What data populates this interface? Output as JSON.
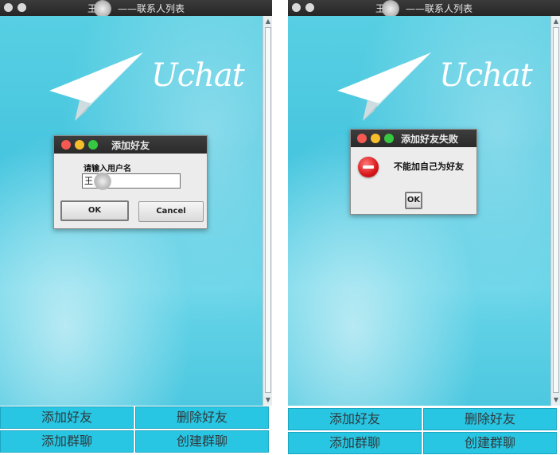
{
  "windows": [
    {
      "title_prefix": "王",
      "title_suffix": "——联系人列表",
      "brand": "Uchat",
      "buttons": {
        "add_friend": "添加好友",
        "delete_friend": "删除好友",
        "add_group": "添加群聊",
        "create_group": "创建群聊"
      },
      "dialog": {
        "title": "添加好友",
        "prompt": "请输入用户名",
        "input_value": "王",
        "ok": "OK",
        "cancel": "Cancel"
      }
    },
    {
      "title_prefix": "王",
      "title_suffix": "——联系人列表",
      "brand": "Uchat",
      "buttons": {
        "add_friend": "添加好友",
        "delete_friend": "删除好友",
        "add_group": "添加群聊",
        "create_group": "创建群聊"
      },
      "dialog": {
        "title": "添加好友失败",
        "message": "不能加自己为好友",
        "ok": "OK",
        "icon": "error-stop-icon"
      }
    }
  ],
  "colors": {
    "background_blue": "#47c6df",
    "button_blue": "#28c6e3",
    "titlebar": "#2a2a2a",
    "error_red": "#d8161a"
  }
}
